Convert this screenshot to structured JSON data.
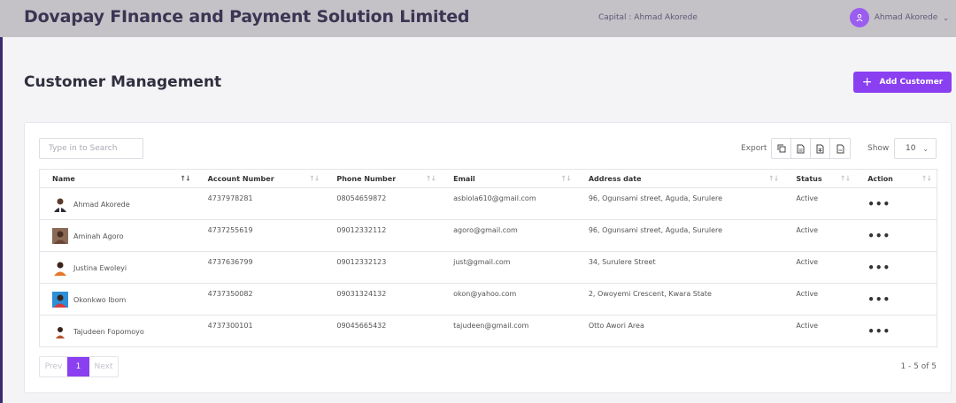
{
  "header": {
    "brand": "Dovapay FInance and Payment Solution Limited",
    "capital": "Capital : Ahmad Akorede",
    "user_name": "Ahmad Akorede"
  },
  "page": {
    "title": "Customer Management",
    "add_button": "Add Customer"
  },
  "toolbar": {
    "search_placeholder": "Type in to Search",
    "export_label": "Export",
    "export_icons": [
      "copy-icon",
      "csv-file-icon",
      "excel-file-icon",
      "pdf-file-icon"
    ],
    "show_label": "Show",
    "show_value": "10"
  },
  "table": {
    "columns": [
      "Name",
      "Account Number",
      "Phone Number",
      "Email",
      "Address date",
      "Status",
      "Action"
    ],
    "rows": [
      {
        "name": "Ahmad Akorede",
        "account": "4737978281",
        "phone": "08054659872",
        "email": "asbiola610@gmail.com",
        "address": "96, Ogunsami street, Aguda, Surulere",
        "status": "Active",
        "action": "•••"
      },
      {
        "name": "Aminah Agoro",
        "account": "4737255619",
        "phone": "09012332112",
        "email": "agoro@gmail.com",
        "address": "96, Ogunsami street, Aguda, Surulere",
        "status": "Active",
        "action": "•••"
      },
      {
        "name": "Justina Ewoleyi",
        "account": "4737636799",
        "phone": "09012332123",
        "email": "just@gmail.com",
        "address": "34, Surulere Street",
        "status": "Active",
        "action": "•••"
      },
      {
        "name": "Okonkwo Ibom",
        "account": "4737350082",
        "phone": "09031324132",
        "email": "okon@yahoo.com",
        "address": "2, Owoyemi Crescent, Kwara State",
        "status": "Active",
        "action": "•••"
      },
      {
        "name": "Tajudeen Fopomoyo",
        "account": "4737300101",
        "phone": "09045665432",
        "email": "tajudeen@gmail.com",
        "address": "Otto Awori Area",
        "status": "Active",
        "action": "•••"
      }
    ]
  },
  "pagination": {
    "prev": "Prev",
    "current": "1",
    "next": "Next",
    "range": "1 - 5 of 5"
  },
  "colors": {
    "accent": "#8a3ff1",
    "header_bg": "#c5c2c7",
    "brand_text": "#3a3553"
  }
}
